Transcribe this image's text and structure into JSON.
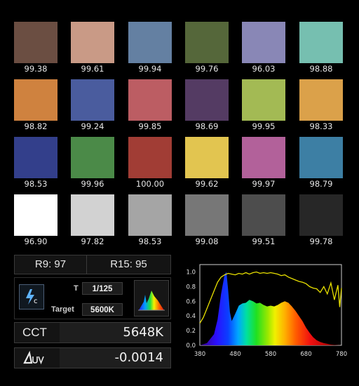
{
  "swatches": [
    {
      "color": "#6b4e42",
      "value": "99.38"
    },
    {
      "color": "#c99a86",
      "value": "99.61"
    },
    {
      "color": "#6480a2",
      "value": "99.94"
    },
    {
      "color": "#55673a",
      "value": "99.76"
    },
    {
      "color": "#8987b6",
      "value": "96.03"
    },
    {
      "color": "#76bfb0",
      "value": "98.88"
    },
    {
      "color": "#cf823f",
      "value": "98.82"
    },
    {
      "color": "#4a5c9e",
      "value": "99.24"
    },
    {
      "color": "#bc5d63",
      "value": "99.85"
    },
    {
      "color": "#543b63",
      "value": "98.69"
    },
    {
      "color": "#a3ba54",
      "value": "99.95"
    },
    {
      "color": "#dba14a",
      "value": "98.33"
    },
    {
      "color": "#333f8b",
      "value": "98.53"
    },
    {
      "color": "#4b8a48",
      "value": "99.96"
    },
    {
      "color": "#a13d35",
      "value": "100.00"
    },
    {
      "color": "#e2c550",
      "value": "99.62"
    },
    {
      "color": "#b2619a",
      "value": "99.97"
    },
    {
      "color": "#3d7fa4",
      "value": "98.79"
    },
    {
      "color": "#ffffff",
      "value": "96.90"
    },
    {
      "color": "#d2d2d2",
      "value": "97.82"
    },
    {
      "color": "#a5a5a5",
      "value": "98.53"
    },
    {
      "color": "#777777",
      "value": "99.08"
    },
    {
      "color": "#4d4d4d",
      "value": "99.51"
    },
    {
      "color": "#272727",
      "value": "99.78"
    }
  ],
  "ratings": {
    "r9": "R9: 97",
    "r15": "R15: 95"
  },
  "params": {
    "t_label": "T",
    "t_value": "1/125",
    "target_label": "Target",
    "target_value": "5600K"
  },
  "metrics": {
    "cct_label": "CCT",
    "cct_value": "5648K",
    "duv_value": "-0.0014"
  },
  "icons": {
    "mode": "lightning-c-icon",
    "thumb": "spectrum-thumbnail-icon"
  },
  "chart_data": {
    "type": "area",
    "x_ticks": [
      "380",
      "480",
      "580",
      "680",
      "780"
    ],
    "y_ticks": [
      "0.0",
      "0.2",
      "0.4",
      "0.6",
      "0.8",
      "1.0"
    ],
    "xlim": [
      380,
      780
    ],
    "ylim": [
      0,
      1.1
    ],
    "series": [
      {
        "x": [
          380,
          400,
          420,
          430,
          440,
          450,
          455,
          460,
          465,
          470,
          480,
          490,
          500,
          510,
          520,
          530,
          540,
          550,
          560,
          570,
          580,
          590,
          600,
          610,
          620,
          630,
          640,
          650,
          660,
          670,
          680,
          690,
          700,
          710,
          720,
          730,
          740,
          750,
          760,
          770,
          780
        ],
        "values": [
          0.0,
          0.03,
          0.15,
          0.35,
          0.7,
          0.96,
          1.0,
          0.75,
          0.45,
          0.33,
          0.43,
          0.54,
          0.57,
          0.58,
          0.62,
          0.6,
          0.57,
          0.58,
          0.55,
          0.53,
          0.54,
          0.53,
          0.55,
          0.58,
          0.6,
          0.58,
          0.53,
          0.47,
          0.4,
          0.33,
          0.24,
          0.17,
          0.11,
          0.07,
          0.045,
          0.03,
          0.02,
          0.01,
          0.005,
          0.002,
          0.0
        ]
      },
      {
        "x": [
          380,
          390,
          400,
          410,
          420,
          430,
          440,
          450,
          460,
          470,
          480,
          490,
          500,
          510,
          520,
          530,
          540,
          550,
          560,
          570,
          580,
          590,
          600,
          610,
          620,
          630,
          640,
          650,
          660,
          670,
          680,
          690,
          700,
          710,
          720,
          730,
          740,
          750,
          760,
          770,
          775,
          780
        ],
        "values": [
          0.3,
          0.38,
          0.5,
          0.62,
          0.74,
          0.86,
          0.93,
          0.96,
          0.98,
          0.97,
          0.96,
          0.98,
          0.97,
          0.99,
          0.97,
          0.99,
          1.0,
          0.98,
          0.99,
          0.98,
          0.99,
          0.98,
          0.97,
          0.95,
          0.96,
          0.93,
          0.91,
          0.89,
          0.87,
          0.86,
          0.84,
          0.8,
          0.78,
          0.77,
          0.72,
          0.8,
          0.7,
          0.85,
          0.62,
          0.82,
          0.52,
          0.78
        ]
      }
    ]
  }
}
